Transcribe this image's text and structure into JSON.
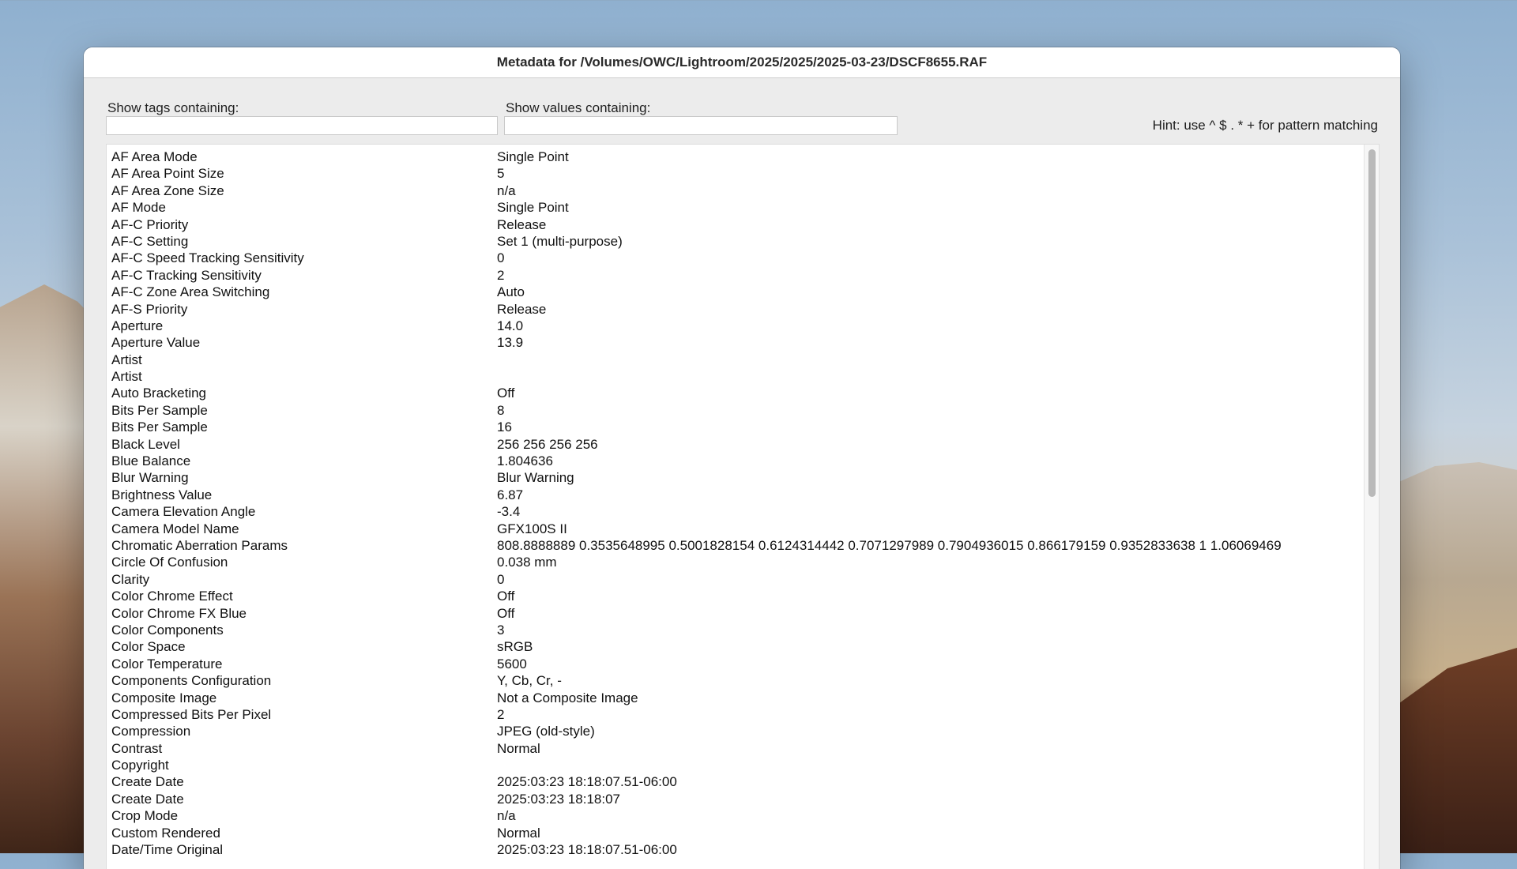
{
  "window": {
    "title": "Metadata for /Volumes/OWC/Lightroom/2025/2025/2025-03-23/DSCF8655.RAF"
  },
  "filters": {
    "tags_label": "Show tags containing:",
    "tags_value": "",
    "values_label": "Show values containing:",
    "values_value": "",
    "hint": "Hint: use ^ $ . * + for pattern matching"
  },
  "rows": [
    {
      "tag": "AF Area Mode",
      "value": "Single Point"
    },
    {
      "tag": "AF Area Point Size",
      "value": "5"
    },
    {
      "tag": "AF Area Zone Size",
      "value": "n/a"
    },
    {
      "tag": "AF Mode",
      "value": "Single Point"
    },
    {
      "tag": "AF-C Priority",
      "value": "Release"
    },
    {
      "tag": "AF-C Setting",
      "value": "Set 1 (multi-purpose)"
    },
    {
      "tag": "AF-C Speed Tracking Sensitivity",
      "value": "0"
    },
    {
      "tag": "AF-C Tracking Sensitivity",
      "value": "2"
    },
    {
      "tag": "AF-C Zone Area Switching",
      "value": "Auto"
    },
    {
      "tag": "AF-S Priority",
      "value": "Release"
    },
    {
      "tag": "Aperture",
      "value": "14.0"
    },
    {
      "tag": "Aperture Value",
      "value": "13.9"
    },
    {
      "tag": "Artist",
      "value": ""
    },
    {
      "tag": "Artist",
      "value": ""
    },
    {
      "tag": "Auto Bracketing",
      "value": "Off"
    },
    {
      "tag": "Bits Per Sample",
      "value": "8"
    },
    {
      "tag": "Bits Per Sample",
      "value": "16"
    },
    {
      "tag": "Black Level",
      "value": "256 256 256 256"
    },
    {
      "tag": "Blue Balance",
      "value": "1.804636"
    },
    {
      "tag": "Blur Warning",
      "value": "Blur Warning"
    },
    {
      "tag": "Brightness Value",
      "value": "6.87"
    },
    {
      "tag": "Camera Elevation Angle",
      "value": "-3.4"
    },
    {
      "tag": "Camera Model Name",
      "value": "GFX100S II"
    },
    {
      "tag": "Chromatic Aberration Params",
      "value": "808.8888889 0.3535648995 0.5001828154 0.6124314442 0.7071297989 0.7904936015 0.866179159 0.9352833638 1 1.06069469"
    },
    {
      "tag": "Circle Of Confusion",
      "value": "0.038 mm"
    },
    {
      "tag": "Clarity",
      "value": "0"
    },
    {
      "tag": "Color Chrome Effect",
      "value": "Off"
    },
    {
      "tag": "Color Chrome FX Blue",
      "value": "Off"
    },
    {
      "tag": "Color Components",
      "value": "3"
    },
    {
      "tag": "Color Space",
      "value": "sRGB"
    },
    {
      "tag": "Color Temperature",
      "value": "5600"
    },
    {
      "tag": "Components Configuration",
      "value": "Y, Cb, Cr, -"
    },
    {
      "tag": "Composite Image",
      "value": "Not a Composite Image"
    },
    {
      "tag": "Compressed Bits Per Pixel",
      "value": "2"
    },
    {
      "tag": "Compression",
      "value": "JPEG (old-style)"
    },
    {
      "tag": "Contrast",
      "value": "Normal"
    },
    {
      "tag": "Copyright",
      "value": ""
    },
    {
      "tag": "Create Date",
      "value": "2025:03:23 18:18:07.51-06:00"
    },
    {
      "tag": "Create Date",
      "value": "2025:03:23 18:18:07"
    },
    {
      "tag": "Crop Mode",
      "value": "n/a"
    },
    {
      "tag": "Custom Rendered",
      "value": "Normal"
    },
    {
      "tag": "Date/Time Original",
      "value": "2025:03:23 18:18:07.51-06:00"
    }
  ]
}
